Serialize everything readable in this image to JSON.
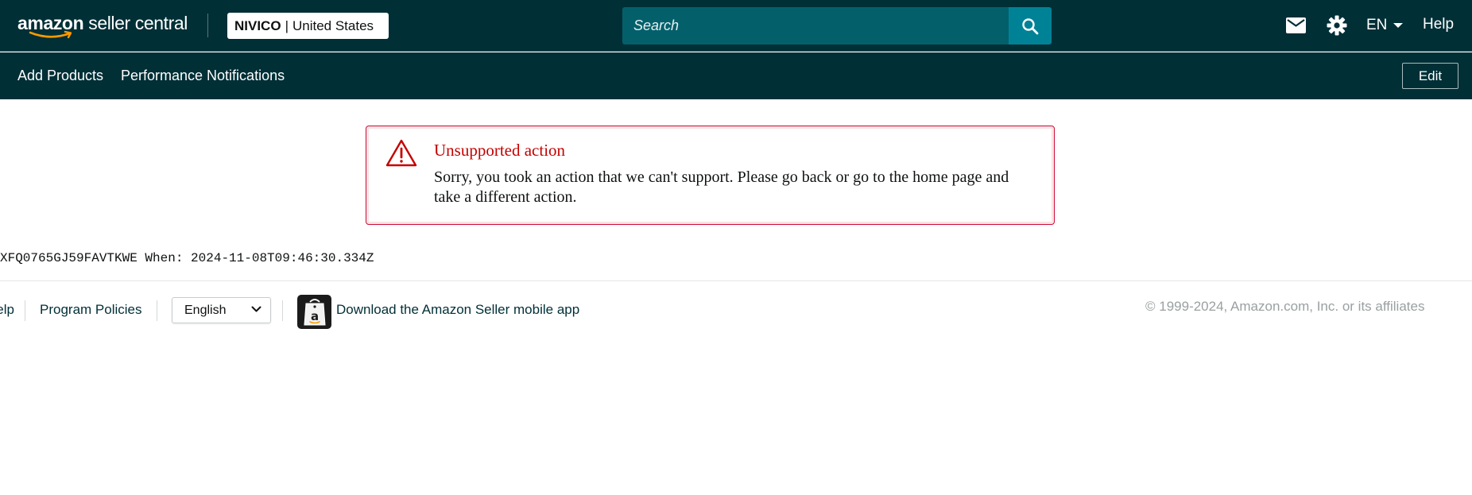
{
  "header": {
    "logo": {
      "brand": "amazon",
      "product": "seller central"
    },
    "account": {
      "name": "NIVICO",
      "separator": "|",
      "marketplace": "United States"
    },
    "search": {
      "placeholder": "Search"
    },
    "icons": {
      "search": "search-icon",
      "mail": "mail-icon",
      "settings": "gear-icon"
    },
    "language": "EN",
    "help": "Help"
  },
  "subnav": {
    "links": [
      "Add Products",
      "Performance Notifications"
    ],
    "edit": "Edit"
  },
  "alert": {
    "title": "Unsupported action",
    "message": "Sorry, you took an action that we can't support. Please go back or go to the home page and take a different action.",
    "icon": "warning-icon"
  },
  "request_info": "XFQ0765GJ59FAVTKWE When: 2024-11-08T09:46:30.334Z",
  "footer": {
    "help": "Help",
    "policies": "Program Policies",
    "language_select": "English",
    "app_link": "Download the Amazon Seller mobile app",
    "copyright": "© 1999-2024, Amazon.com, Inc. or its affiliates"
  },
  "colors": {
    "header_bg": "#002f36",
    "search_bg": "#03606b",
    "search_button": "#008296",
    "alert_red": "#c40000",
    "link": "#002f36"
  }
}
